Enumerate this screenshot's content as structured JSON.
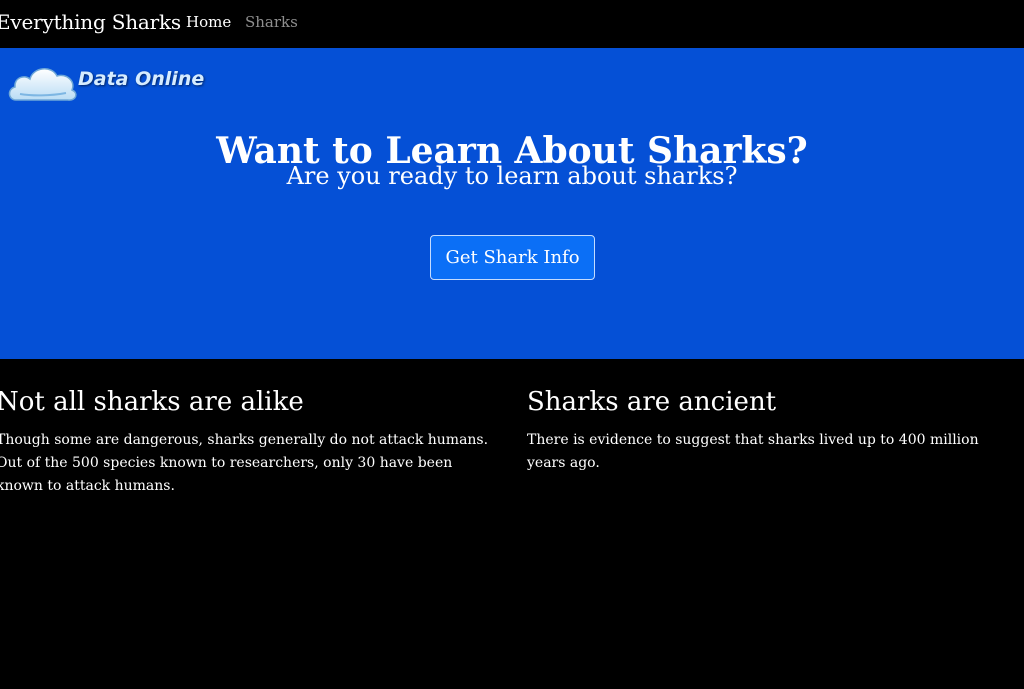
{
  "navbar": {
    "brand": "Everything Sharks",
    "links": [
      {
        "label": "Home",
        "active": true
      },
      {
        "label": "Sharks",
        "active": false
      }
    ]
  },
  "logo": {
    "text": "Data Online",
    "icon": "cloud-icon"
  },
  "hero": {
    "title": "Want to Learn About Sharks?",
    "subtitle": "Are you ready to learn about sharks?",
    "button_label": "Get Shark Info"
  },
  "columns": [
    {
      "heading": "Not all sharks are alike",
      "body": "Though some are dangerous, sharks generally do not attack humans. Out of the 500 species known to researchers, only 30 have been known to attack humans."
    },
    {
      "heading": "Sharks are ancient",
      "body": "There is evidence to suggest that sharks lived up to 400 million years ago."
    }
  ],
  "colors": {
    "page_background": "#000000",
    "hero_background": "#0550d6",
    "button_background": "#0b6ff6",
    "nav_inactive": "#8e8e8e"
  }
}
